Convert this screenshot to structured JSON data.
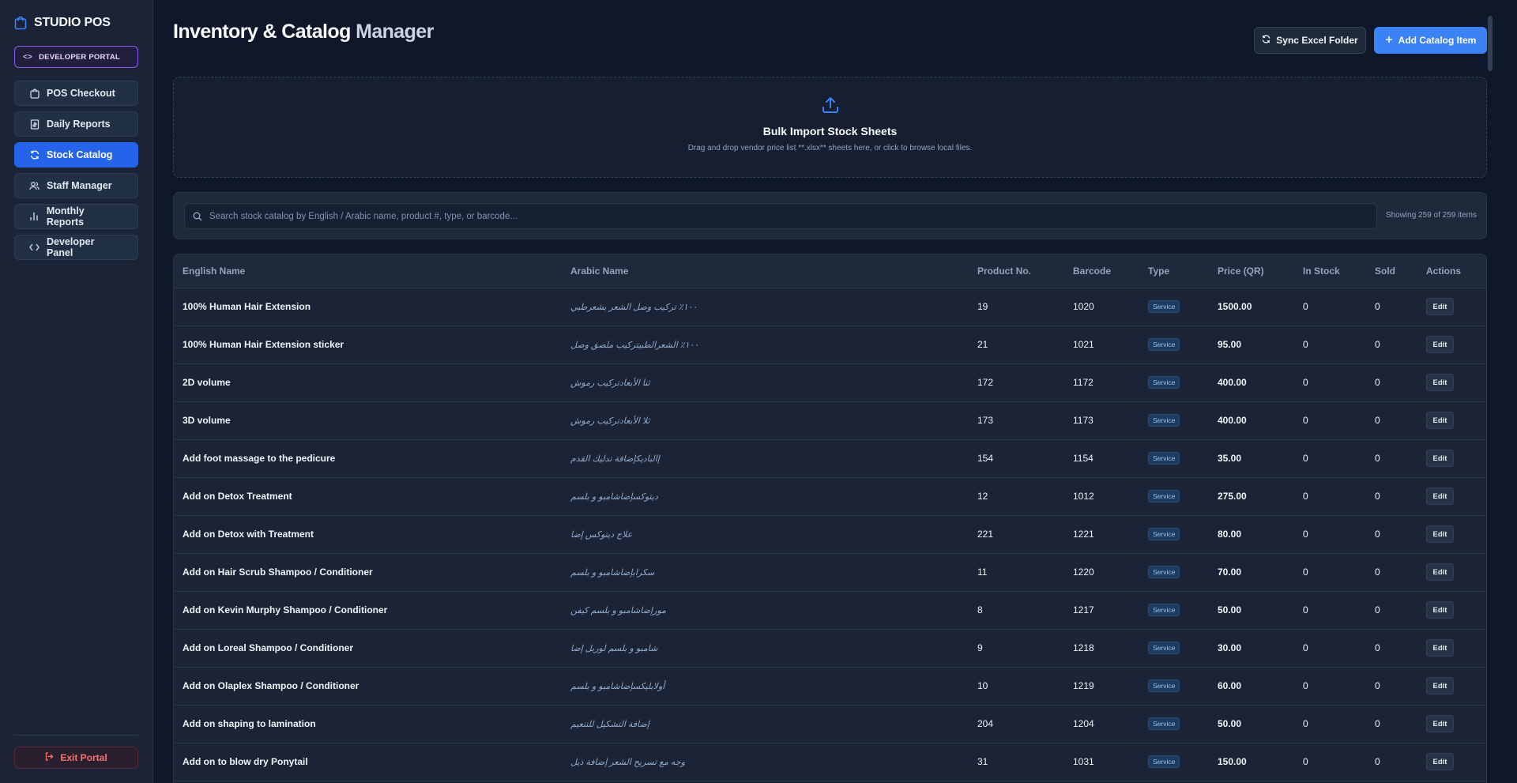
{
  "brand": {
    "name": "STUDIO POS",
    "icon": "shopping-bag-icon"
  },
  "dev_portal": {
    "label": "DEVELOPER PORTAL",
    "icon": "code-icon"
  },
  "nav": [
    {
      "label": "POS Checkout",
      "icon": "shopping-bag-icon",
      "active": false
    },
    {
      "label": "Daily Reports",
      "icon": "receipt-icon",
      "active": false
    },
    {
      "label": "Stock Catalog",
      "icon": "refresh-icon",
      "active": true
    },
    {
      "label": "Staff Manager",
      "icon": "users-icon",
      "active": false
    },
    {
      "label": "Monthly Reports",
      "icon": "bar-chart-icon",
      "active": false
    },
    {
      "label": "Developer Panel",
      "icon": "code-icon",
      "active": false
    }
  ],
  "exit": {
    "label": "Exit Portal",
    "icon": "logout-icon"
  },
  "header": {
    "title_main": "Inventory & Catalog",
    "title_muted": "Manager",
    "sync_label": "Sync Excel Folder",
    "add_label": "Add Catalog Item"
  },
  "dropzone": {
    "title": "Bulk Import Stock Sheets",
    "subtitle": "Drag and drop vendor price list **.xlsx** sheets here, or click to browse local files.",
    "icon": "upload-icon"
  },
  "search": {
    "placeholder": "Search stock catalog by English / Arabic name, product #, type, or barcode...",
    "count_text": "Showing 259 of 259 items"
  },
  "table": {
    "columns": [
      "English Name",
      "Arabic Name",
      "Product No.",
      "Barcode",
      "Type",
      "Price (QR)",
      "In Stock",
      "Sold",
      "Actions"
    ],
    "edit_label": "Edit",
    "rows": [
      {
        "en": "100% Human Hair Extension",
        "ar": "١٠٠٪ تركيب وصل الشعر بشعرطبي",
        "product_no": "19",
        "barcode": "1020",
        "type": "Service",
        "price": "1500.00",
        "in_stock": "0",
        "sold": "0"
      },
      {
        "en": "100% Human Hair Extension sticker",
        "ar": "١٠٠٪ الشعرالطبيتركيب ملصق وصل",
        "product_no": "21",
        "barcode": "1021",
        "type": "Service",
        "price": "95.00",
        "in_stock": "0",
        "sold": "0"
      },
      {
        "en": "2D volume",
        "ar": "ثنا الأبعادتركيب رموش",
        "product_no": "172",
        "barcode": "1172",
        "type": "Service",
        "price": "400.00",
        "in_stock": "0",
        "sold": "0"
      },
      {
        "en": "3D volume",
        "ar": "ثلا الأبعادتركيب رموش",
        "product_no": "173",
        "barcode": "1173",
        "type": "Service",
        "price": "400.00",
        "in_stock": "0",
        "sold": "0"
      },
      {
        "en": "Add foot massage to the pedicure",
        "ar": "إالباديكإضافة تدليك القدم",
        "product_no": "154",
        "barcode": "1154",
        "type": "Service",
        "price": "35.00",
        "in_stock": "0",
        "sold": "0"
      },
      {
        "en": "Add on Detox Treatment",
        "ar": "ديتوكسإضاشامبو و بلسم",
        "product_no": "12",
        "barcode": "1012",
        "type": "Service",
        "price": "275.00",
        "in_stock": "0",
        "sold": "0"
      },
      {
        "en": "Add on Detox with Treatment",
        "ar": "علاج ديتوكس إضا",
        "product_no": "221",
        "barcode": "1221",
        "type": "Service",
        "price": "80.00",
        "in_stock": "0",
        "sold": "0"
      },
      {
        "en": "Add on Hair Scrub Shampoo / Conditioner",
        "ar": "سكرابإضاشامبو و بلسم",
        "product_no": "11",
        "barcode": "1220",
        "type": "Service",
        "price": "70.00",
        "in_stock": "0",
        "sold": "0"
      },
      {
        "en": "Add on Kevin Murphy Shampoo / Conditioner",
        "ar": "مورإضاشامبو و بلسم كيفن",
        "product_no": "8",
        "barcode": "1217",
        "type": "Service",
        "price": "50.00",
        "in_stock": "0",
        "sold": "0"
      },
      {
        "en": "Add on Loreal Shampoo / Conditioner",
        "ar": "شامبو و بلسم لوريل إضا",
        "product_no": "9",
        "barcode": "1218",
        "type": "Service",
        "price": "30.00",
        "in_stock": "0",
        "sold": "0"
      },
      {
        "en": "Add on Olaplex Shampoo / Conditioner",
        "ar": "أولابليكسإضاشامبو و بلسم",
        "product_no": "10",
        "barcode": "1219",
        "type": "Service",
        "price": "60.00",
        "in_stock": "0",
        "sold": "0"
      },
      {
        "en": "Add on shaping to lamination",
        "ar": "إضافة التشكيل للتنعيم",
        "product_no": "204",
        "barcode": "1204",
        "type": "Service",
        "price": "50.00",
        "in_stock": "0",
        "sold": "0"
      },
      {
        "en": "Add on to blow dry Ponytail",
        "ar": "وجه مع تسريح الشعر إضافة ذيل",
        "product_no": "31",
        "barcode": "1031",
        "type": "Service",
        "price": "150.00",
        "in_stock": "0",
        "sold": "0"
      }
    ]
  }
}
